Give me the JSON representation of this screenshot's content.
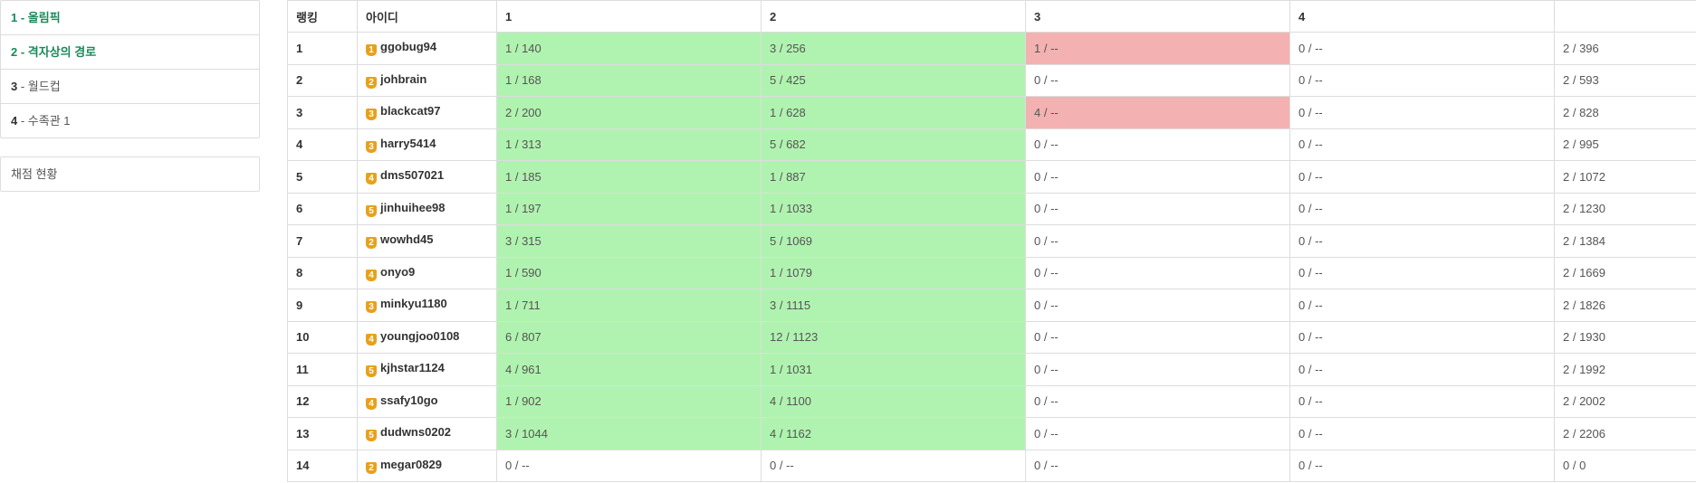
{
  "sidebar": {
    "problems": [
      {
        "num": "1",
        "sep": " - ",
        "title": "올림픽",
        "accent": true
      },
      {
        "num": "2",
        "sep": " - ",
        "title": "격자상의 경로",
        "accent": true
      },
      {
        "num": "3",
        "sep": " - ",
        "title": "월드컵",
        "accent": false
      },
      {
        "num": "4",
        "sep": " - ",
        "title": "수족관 1",
        "accent": false
      }
    ],
    "status_link": "채점 현황"
  },
  "colors": {
    "accepted": "#b0f3b0",
    "wrong": "#f4b1b1",
    "accent_text": "#1a8a5a",
    "tier_badge": "#e8a11a"
  },
  "table": {
    "headers": [
      "랭킹",
      "아이디",
      "1",
      "2",
      "3",
      "4",
      ""
    ],
    "rows": [
      {
        "rank": "1",
        "tier": "1",
        "user": "ggobug94",
        "cells": [
          "1 / 140",
          "3 / 256",
          "1 / --",
          "0 / --",
          "2 / 396"
        ],
        "status": [
          "ac",
          "ac",
          "wa",
          "",
          ""
        ]
      },
      {
        "rank": "2",
        "tier": "2",
        "user": "johbrain",
        "cells": [
          "1 / 168",
          "5 / 425",
          "0 / --",
          "0 / --",
          "2 / 593"
        ],
        "status": [
          "ac",
          "ac",
          "",
          "",
          ""
        ]
      },
      {
        "rank": "3",
        "tier": "3",
        "user": "blackcat97",
        "cells": [
          "2 / 200",
          "1 / 628",
          "4 / --",
          "0 / --",
          "2 / 828"
        ],
        "status": [
          "ac",
          "ac",
          "wa",
          "",
          ""
        ]
      },
      {
        "rank": "4",
        "tier": "3",
        "user": "harry5414",
        "cells": [
          "1 / 313",
          "5 / 682",
          "0 / --",
          "0 / --",
          "2 / 995"
        ],
        "status": [
          "ac",
          "ac",
          "",
          "",
          ""
        ]
      },
      {
        "rank": "5",
        "tier": "4",
        "user": "dms507021",
        "cells": [
          "1 / 185",
          "1 / 887",
          "0 / --",
          "0 / --",
          "2 / 1072"
        ],
        "status": [
          "ac",
          "ac",
          "",
          "",
          ""
        ]
      },
      {
        "rank": "6",
        "tier": "5",
        "user": "jinhuihee98",
        "cells": [
          "1 / 197",
          "1 / 1033",
          "0 / --",
          "0 / --",
          "2 / 1230"
        ],
        "status": [
          "ac",
          "ac",
          "",
          "",
          ""
        ]
      },
      {
        "rank": "7",
        "tier": "2",
        "user": "wowhd45",
        "cells": [
          "3 / 315",
          "5 / 1069",
          "0 / --",
          "0 / --",
          "2 / 1384"
        ],
        "status": [
          "ac",
          "ac",
          "",
          "",
          ""
        ]
      },
      {
        "rank": "8",
        "tier": "4",
        "user": "onyo9",
        "cells": [
          "1 / 590",
          "1 / 1079",
          "0 / --",
          "0 / --",
          "2 / 1669"
        ],
        "status": [
          "ac",
          "ac",
          "",
          "",
          ""
        ]
      },
      {
        "rank": "9",
        "tier": "3",
        "user": "minkyu1180",
        "cells": [
          "1 / 711",
          "3 / 1115",
          "0 / --",
          "0 / --",
          "2 / 1826"
        ],
        "status": [
          "ac",
          "ac",
          "",
          "",
          ""
        ]
      },
      {
        "rank": "10",
        "tier": "4",
        "user": "youngjoo0108",
        "cells": [
          "6 / 807",
          "12 / 1123",
          "0 / --",
          "0 / --",
          "2 / 1930"
        ],
        "status": [
          "ac",
          "ac",
          "",
          "",
          ""
        ]
      },
      {
        "rank": "11",
        "tier": "5",
        "user": "kjhstar1124",
        "cells": [
          "4 / 961",
          "1 / 1031",
          "0 / --",
          "0 / --",
          "2 / 1992"
        ],
        "status": [
          "ac",
          "ac",
          "",
          "",
          ""
        ]
      },
      {
        "rank": "12",
        "tier": "4",
        "user": "ssafy10go",
        "cells": [
          "1 / 902",
          "4 / 1100",
          "0 / --",
          "0 / --",
          "2 / 2002"
        ],
        "status": [
          "ac",
          "ac",
          "",
          "",
          ""
        ]
      },
      {
        "rank": "13",
        "tier": "5",
        "user": "dudwns0202",
        "cells": [
          "3 / 1044",
          "4 / 1162",
          "0 / --",
          "0 / --",
          "2 / 2206"
        ],
        "status": [
          "ac",
          "ac",
          "",
          "",
          ""
        ]
      },
      {
        "rank": "14",
        "tier": "2",
        "user": "megar0829",
        "cells": [
          "0 / --",
          "0 / --",
          "0 / --",
          "0 / --",
          "0 / 0"
        ],
        "status": [
          "",
          "",
          "",
          "",
          ""
        ]
      }
    ]
  }
}
